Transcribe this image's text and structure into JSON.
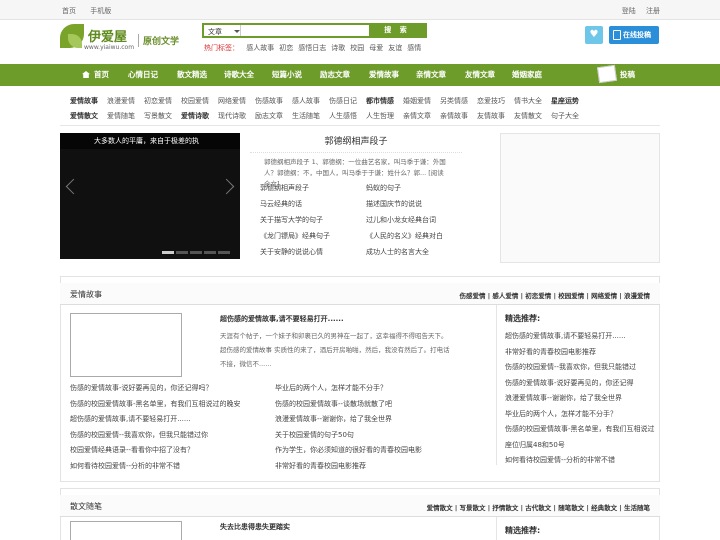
{
  "topbar": {
    "home": "首页",
    "mobile": "手机版",
    "login": "登陆",
    "register": "注册"
  },
  "logo": {
    "name": "伊爱屋",
    "url": "www.yiaiwu.com",
    "tagline": "原创文学"
  },
  "search": {
    "type_selected": "文章",
    "placeholder": "",
    "button": "搜 索"
  },
  "hot_tags": {
    "label": "热门标签：",
    "tags": [
      "感人故事",
      "初恋",
      "感悟日志",
      "诗歌",
      "校园",
      "母爱",
      "友谊",
      "感情"
    ]
  },
  "contribute": "在线投稿",
  "nav": [
    "首页",
    "心情日记",
    "散文精选",
    "诗歌大全",
    "短篇小说",
    "励志文章",
    "爱情故事",
    "亲情文章",
    "友情文章",
    "婚姻家庭",
    "投稿"
  ],
  "subnav": {
    "row1": [
      "爱情故事",
      "浪漫爱情",
      "初恋爱情",
      "校园爱情",
      "网络爱情",
      "伤感故事",
      "感人故事",
      "伤感日记",
      "都市情感",
      "婚姻爱情",
      "另类情感",
      "恋爱技巧",
      "情书大全",
      "星座运势"
    ],
    "row2": [
      "爱情散文",
      "爱情随笔",
      "写景散文",
      "爱情诗歌",
      "现代诗歌",
      "励志文章",
      "生活随笔",
      "人生感悟",
      "人生哲理",
      "亲情文章",
      "亲情故事",
      "友情故事",
      "友情散文",
      "句子大全"
    ]
  },
  "slider": {
    "caption": "大多数人的平庸，来自于极差的执"
  },
  "featured": {
    "title": "郭德纲相声段子",
    "desc": "郭德纲相声段子 1、郭德纲：一位曲艺名家，叫马季于谦：外国人？郭德纲：不，中国人，叫马季于于谦：姓什么？郭... [阅读全文]",
    "links": [
      "郭德纲相声段子",
      "蚂蚁的句子",
      "马云经典的话",
      "描述国庆节的说说",
      "关于描写大学的句子",
      "过儿和小龙女经典台词",
      "《龙门镖局》经典句子",
      "《人民的名义》经典对白",
      "关于安静的说说心情",
      "成功人士的名言大全"
    ]
  },
  "section1": {
    "title": "爱情故事",
    "tags": "伤感爱情 | 感人爱情 | 初恋爱情 | 校园爱情 | 网络爱情 | 浪漫爱情",
    "feature_title": "超伤感的爱情故事,请不要轻易打开......",
    "feature_desc": "天涯有个帖子，一个妹子和卯裹已久的男神在一起了，这幸福得不得昭告天下。 超伤感的爱情故事 实质性的来了，酒后开房啪啪，然后，我没有然后了。打电话不接，微信不......",
    "list": [
      "伤感的爱情故事-说好要再见的，你还记得吗？",
      "毕业后的两个人，怎样才能不分手？",
      "伤感的校园爱情故事-黑名单里，有我们互相说过的晚安",
      "伤感的校园爱情故事--谈散场就散了吧",
      "超伤感的爱情故事,请不要轻易打开......",
      "浪漫爱情故事--谢谢你，给了我全世界",
      "伤感的校园爱情--我喜欢你，但我只能错过你",
      "关于校园爱情的句子50句",
      "校园爱情经典语录--看看你中招了没有？",
      "作为学生，你必须知道的很好看的青春校园电影",
      "如何看待校园爱情--分析的非常不错",
      "非常好看的青春校园电影推荐"
    ],
    "side_title": "精选推荐:",
    "side": [
      "超伤感的爱情故事,请不要轻易打开......",
      "非常好看的青春校园电影推荐",
      "伤感的校园爱情--我喜欢你，但我只能错过",
      "伤感的爱情故事-说好要再见的，你还记得",
      "浪漫爱情故事--谢谢你，给了我全世界",
      "毕业后的两个人，怎样才能不分手？",
      "伤感的校园爱情故事-黑名单里，有我们互相说过",
      "座位归属48和50号",
      "如何看待校园爱情--分析的非常不错"
    ]
  },
  "section2": {
    "title": "散文随笔",
    "tags": "爱情散文 | 写景散文 | 抒情散文 | 古代散文 | 随笔散文 | 经典散文 | 生活随笔",
    "feature_title": "失去比患得患失更踏实",
    "side_title": "精选推荐:"
  }
}
